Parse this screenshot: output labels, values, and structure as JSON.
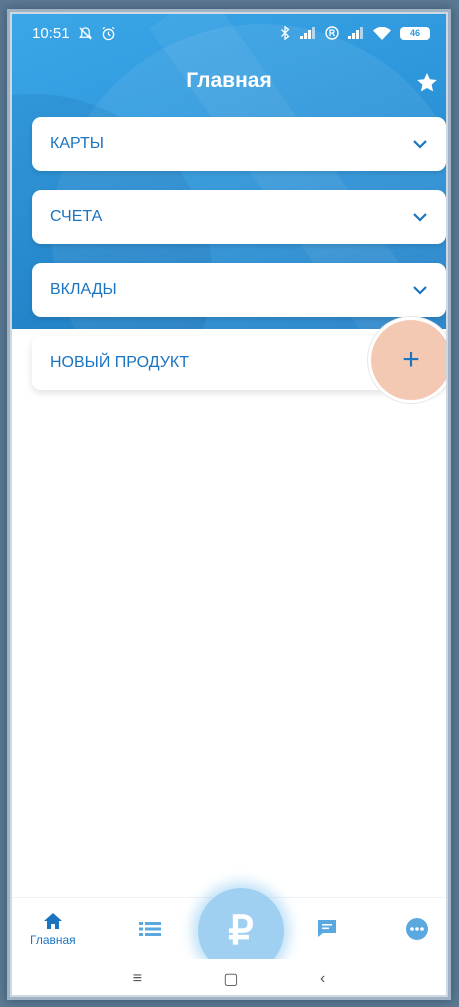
{
  "status_bar": {
    "time": "10:51",
    "battery": "46"
  },
  "header": {
    "title": "Главная"
  },
  "sections": [
    {
      "label": "КАРТЫ"
    },
    {
      "label": "СЧЕТА"
    },
    {
      "label": "ВКЛАДЫ"
    }
  ],
  "new_product": {
    "label": "НОВЫЙ ПРОДУКТ",
    "plus_glyph": "+"
  },
  "bottom_nav": {
    "home_label": "Главная",
    "center_glyph": "₽"
  },
  "system_nav": {
    "menu_glyph": "≡",
    "home_glyph": "▢",
    "back_glyph": "‹"
  },
  "colors": {
    "accent": "#1a74c0",
    "header": "#2e96db",
    "fab": "#9fd0f2",
    "highlight": "#f4c9b4"
  },
  "icons": [
    "bell-off-icon",
    "alarm-icon",
    "bluetooth-icon",
    "signal-icon",
    "roaming-icon",
    "wifi-icon",
    "battery-icon",
    "star-icon",
    "chevron-down-icon",
    "home-icon",
    "list-icon",
    "rouble-icon",
    "chat-icon",
    "more-icon"
  ]
}
